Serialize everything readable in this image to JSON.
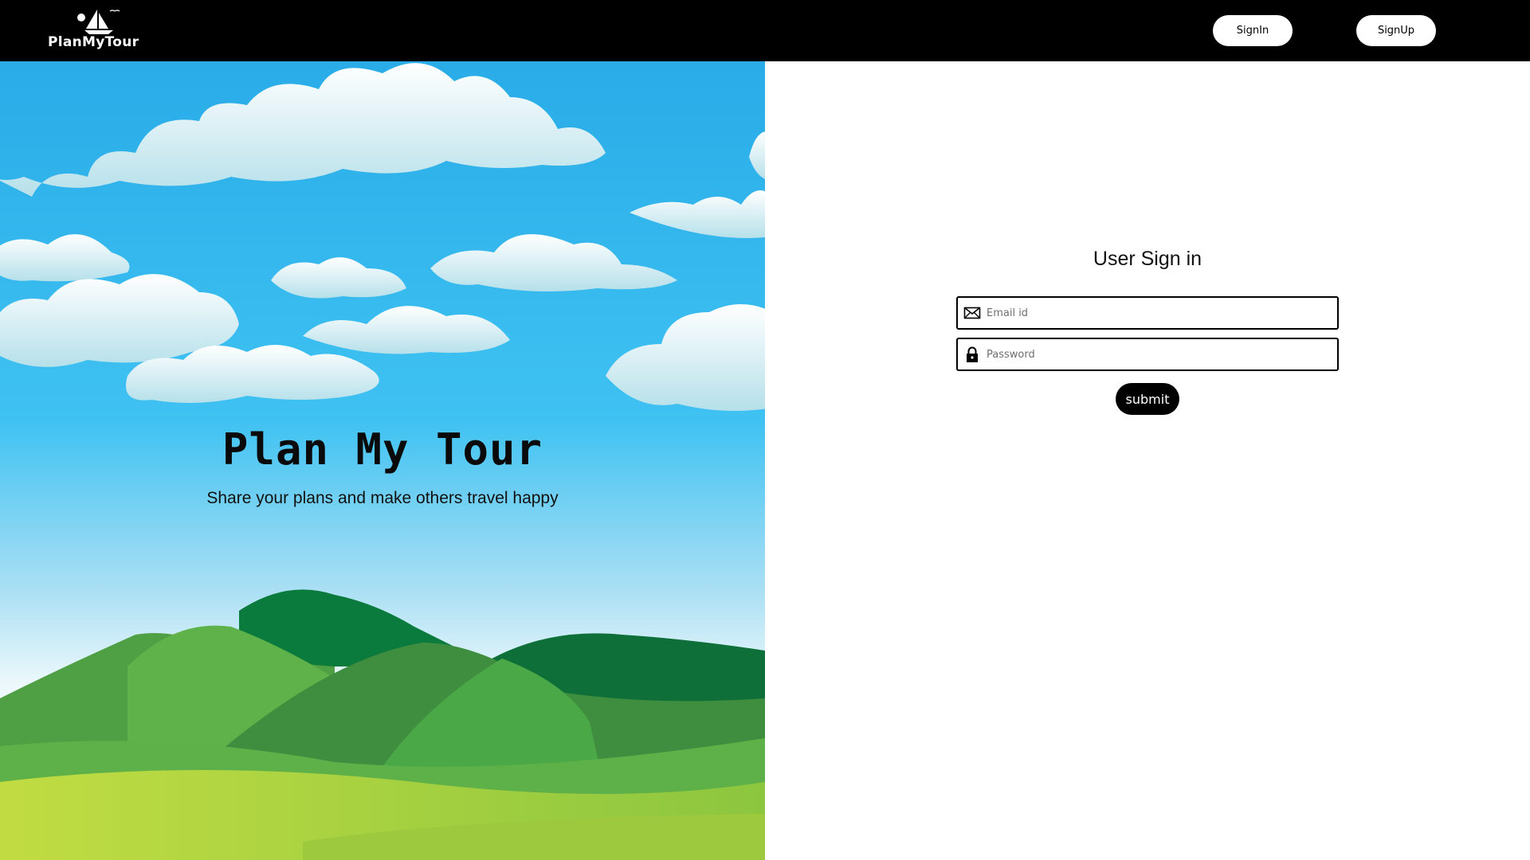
{
  "header": {
    "logo_text": "PlanMyTour",
    "logo_icon": "sailboat-icon",
    "signin_label": "SignIn",
    "signup_label": "SignUp"
  },
  "hero": {
    "title": "Plan My Tour",
    "subtitle": "Share your plans and make others travel happy",
    "background": "sky-clouds-hills-illustration"
  },
  "signin_form": {
    "title": "User Sign in",
    "email_placeholder": "Email id",
    "email_icon": "envelope-icon",
    "password_placeholder": "Password",
    "password_icon": "lock-icon",
    "submit_label": "submit"
  },
  "colors": {
    "header_bg": "#000000",
    "sky_top": "#2aaee9",
    "sky_bottom": "#e8f6fb",
    "hill_dark": "#0c7a3e",
    "hill_mid": "#4ea846",
    "meadow": "#bdd93f"
  }
}
